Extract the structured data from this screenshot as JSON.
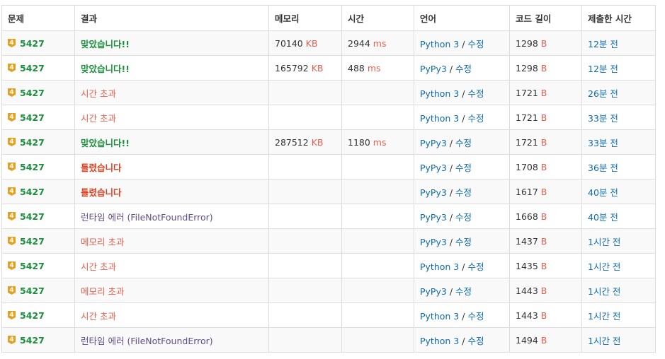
{
  "colors": {
    "accepted": "#1a8f3c",
    "error": "#e5604f",
    "wrong": "#dd4124",
    "runtime": "#5f4d8b",
    "link": "#0d6bb1",
    "tier_badge": "#e2a11f"
  },
  "headers": [
    "문제",
    "결과",
    "메모리",
    "시간",
    "언어",
    "코드 길이",
    "제출한 시간"
  ],
  "units": {
    "memory": "KB",
    "time": "ms",
    "length": "B"
  },
  "edit_label": "수정",
  "tier_badge_text": "4",
  "rows": [
    {
      "problem": "5427",
      "result": "맞았습니다!!",
      "result_type": "ac",
      "result_detail": "",
      "memory": "70140",
      "time": "2944",
      "language": "Python 3",
      "length": "1298",
      "submitted": "12분 전"
    },
    {
      "problem": "5427",
      "result": "맞았습니다!!",
      "result_type": "ac",
      "result_detail": "",
      "memory": "165792",
      "time": "488",
      "language": "PyPy3",
      "length": "1298",
      "submitted": "12분 전"
    },
    {
      "problem": "5427",
      "result": "시간 초과",
      "result_type": "tle",
      "result_detail": "",
      "memory": "",
      "time": "",
      "language": "Python 3",
      "length": "1721",
      "submitted": "26분 전"
    },
    {
      "problem": "5427",
      "result": "시간 초과",
      "result_type": "tle",
      "result_detail": "",
      "memory": "",
      "time": "",
      "language": "Python 3",
      "length": "1721",
      "submitted": "33분 전"
    },
    {
      "problem": "5427",
      "result": "맞았습니다!!",
      "result_type": "ac",
      "result_detail": "",
      "memory": "287512",
      "time": "1180",
      "language": "PyPy3",
      "length": "1721",
      "submitted": "33분 전"
    },
    {
      "problem": "5427",
      "result": "틀렸습니다",
      "result_type": "wa",
      "result_detail": "",
      "memory": "",
      "time": "",
      "language": "PyPy3",
      "length": "1708",
      "submitted": "36분 전"
    },
    {
      "problem": "5427",
      "result": "틀렸습니다",
      "result_type": "wa",
      "result_detail": "",
      "memory": "",
      "time": "",
      "language": "PyPy3",
      "length": "1617",
      "submitted": "40분 전"
    },
    {
      "problem": "5427",
      "result": "런타임 에러",
      "result_type": "rte",
      "result_detail": "(FileNotFoundError)",
      "memory": "",
      "time": "",
      "language": "PyPy3",
      "length": "1668",
      "submitted": "40분 전"
    },
    {
      "problem": "5427",
      "result": "메모리 초과",
      "result_type": "mle",
      "result_detail": "",
      "memory": "",
      "time": "",
      "language": "PyPy3",
      "length": "1437",
      "submitted": "1시간 전"
    },
    {
      "problem": "5427",
      "result": "시간 초과",
      "result_type": "tle",
      "result_detail": "",
      "memory": "",
      "time": "",
      "language": "Python 3",
      "length": "1435",
      "submitted": "1시간 전"
    },
    {
      "problem": "5427",
      "result": "메모리 초과",
      "result_type": "mle",
      "result_detail": "",
      "memory": "",
      "time": "",
      "language": "PyPy3",
      "length": "1443",
      "submitted": "1시간 전"
    },
    {
      "problem": "5427",
      "result": "시간 초과",
      "result_type": "tle",
      "result_detail": "",
      "memory": "",
      "time": "",
      "language": "Python 3",
      "length": "1443",
      "submitted": "1시간 전"
    },
    {
      "problem": "5427",
      "result": "런타임 에러",
      "result_type": "rte",
      "result_detail": "(FileNotFoundError)",
      "memory": "",
      "time": "",
      "language": "Python 3",
      "length": "1494",
      "submitted": "1시간 전"
    }
  ]
}
